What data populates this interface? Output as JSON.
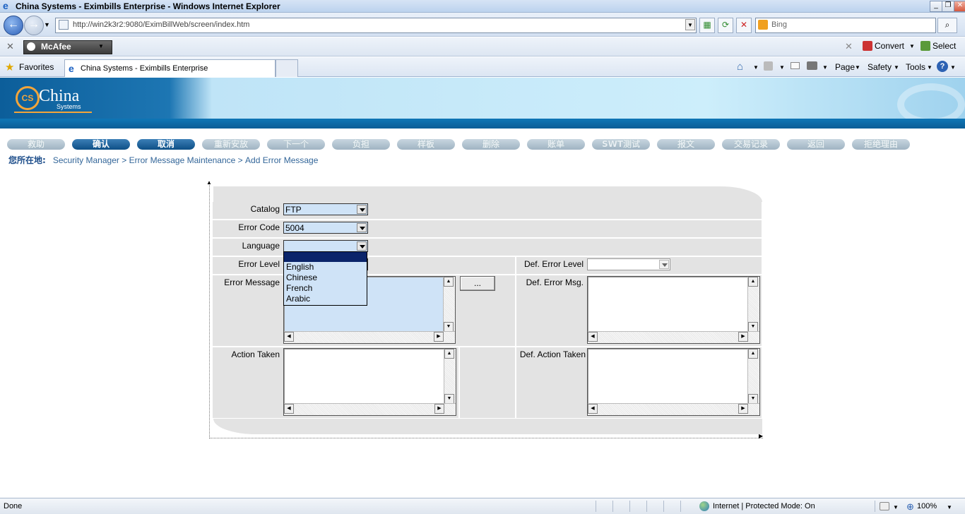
{
  "browser": {
    "title": "China Systems - Eximbills Enterprise - Windows Internet Explorer",
    "url": "http://win2k3r2:9080/EximBillWeb/screen/index.htm",
    "search_placeholder": "Bing",
    "mcafee_label": "McAfee",
    "convert_label": "Convert",
    "select_label": "Select",
    "favorites_label": "Favorites",
    "tab_title": "China Systems - Eximbills Enterprise",
    "commands": {
      "page": "Page",
      "safety": "Safety",
      "tools": "Tools"
    },
    "status_text": "Done",
    "zone_text": "Internet | Protected Mode: On",
    "zoom": "100%"
  },
  "app": {
    "logo_name": "China",
    "logo_sub": "Systems",
    "logo_mark": "CS",
    "toolbar": [
      {
        "label": "救助",
        "enabled": false
      },
      {
        "label": "确认",
        "enabled": true
      },
      {
        "label": "取消",
        "enabled": true
      },
      {
        "label": "重新安放",
        "enabled": false
      },
      {
        "label": "下一个",
        "enabled": false
      },
      {
        "label": "负担",
        "enabled": false
      },
      {
        "label": "样板",
        "enabled": false
      },
      {
        "label": "删除",
        "enabled": false
      },
      {
        "label": "账单",
        "enabled": false
      },
      {
        "label": "SWT测试",
        "enabled": false
      },
      {
        "label": "报文",
        "enabled": false
      },
      {
        "label": "交易记录",
        "enabled": false
      },
      {
        "label": "返回",
        "enabled": false
      },
      {
        "label": "拒绝理由",
        "enabled": false
      }
    ],
    "breadcrumb": {
      "lead": "您所在地:",
      "items": [
        "Security Manager",
        "Error Message Maintenance",
        "Add Error Message"
      ],
      "sep": ">"
    }
  },
  "form": {
    "catalog": {
      "label": "Catalog",
      "value": "FTP"
    },
    "error_code": {
      "label": "Error Code",
      "value": "5004"
    },
    "language": {
      "label": "Language",
      "value": "",
      "options": [
        "English",
        "Chinese",
        "French",
        "Arabic"
      ]
    },
    "error_level": {
      "label": "Error Level"
    },
    "def_error_level": {
      "label": "Def. Error Level",
      "value": ""
    },
    "error_message": {
      "label": "Error Message",
      "value": ""
    },
    "ellipsis_label": "...",
    "def_error_msg": {
      "label": "Def. Error Msg.",
      "value": ""
    },
    "action_taken": {
      "label": "Action Taken",
      "value": ""
    },
    "def_action_taken": {
      "label": "Def. Action Taken",
      "value": ""
    }
  },
  "colors": {
    "enabled_button": "#1d5f96",
    "disabled_button": "#b0c2cf",
    "breadcrumb": "#336699",
    "field_bg": "#cfe3f7",
    "panel_bg": "#e3e3e3"
  }
}
